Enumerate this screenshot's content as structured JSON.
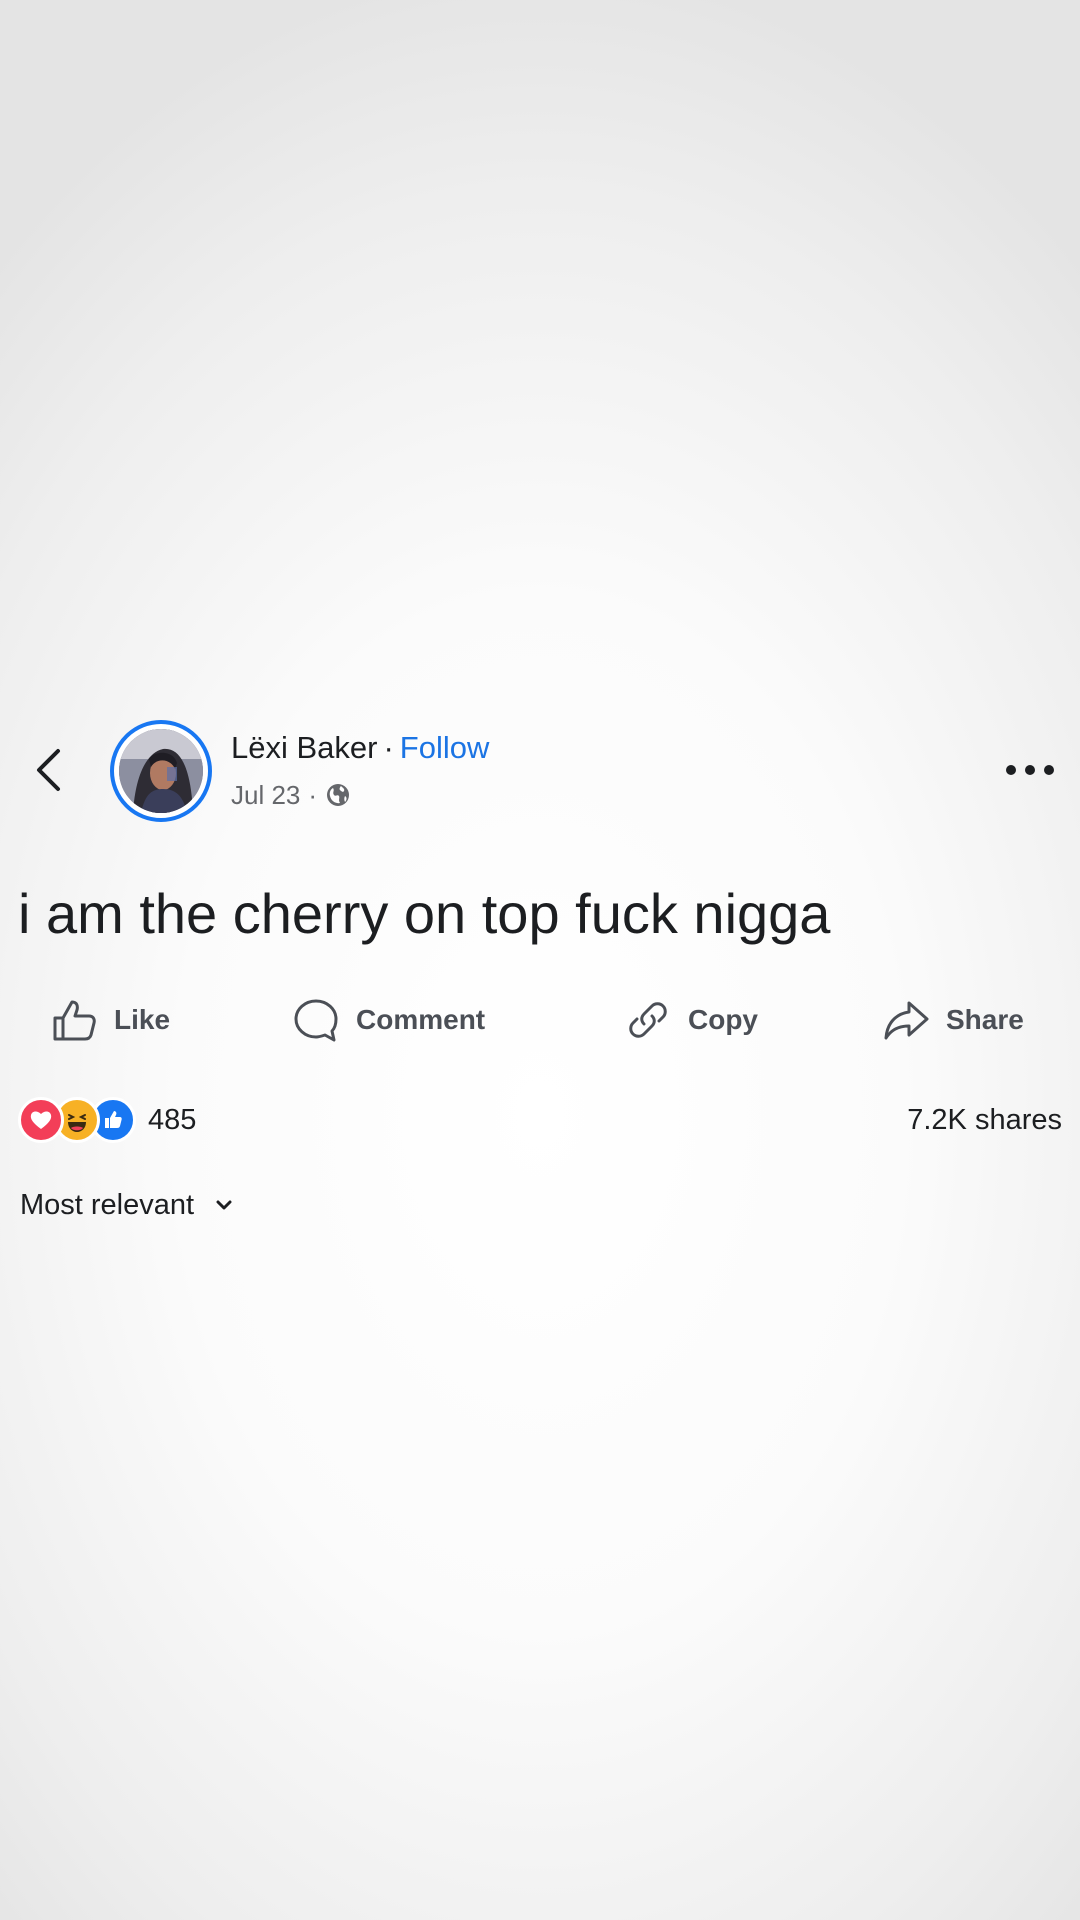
{
  "post": {
    "author": {
      "name": "Lëxi Baker",
      "separator": "·",
      "follow_label": "Follow"
    },
    "meta": {
      "date": "Jul 23",
      "separator": "·",
      "audience_icon": "globe-icon"
    },
    "text": "i am the cherry on top fuck nigga"
  },
  "actions": [
    {
      "label": "Like",
      "icon": "thumbs-up-icon"
    },
    {
      "label": "Comment",
      "icon": "comment-bubble-icon"
    },
    {
      "label": "Copy",
      "icon": "link-icon"
    },
    {
      "label": "Share",
      "icon": "share-arrow-icon"
    }
  ],
  "reactions": {
    "icons": [
      "love-reaction",
      "haha-reaction",
      "like-reaction"
    ],
    "count": "485"
  },
  "shares": "7.2K shares",
  "sort": {
    "label": "Most relevant"
  },
  "colors": {
    "accent": "#1877f2",
    "follow": "#1b74e4",
    "text": "#1c1e21",
    "secondary": "#65676b",
    "love": "#f33e58",
    "haha": "#f7b125"
  }
}
